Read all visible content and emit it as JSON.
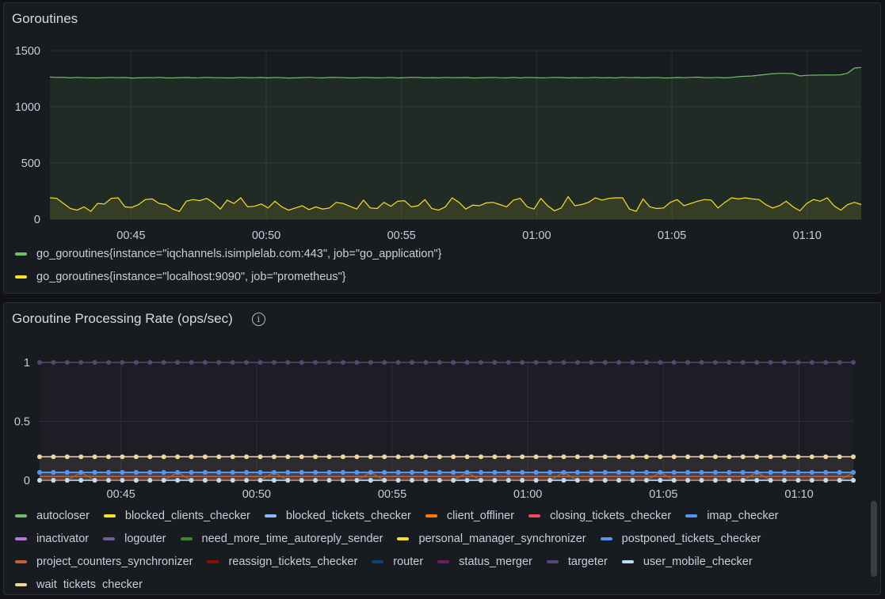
{
  "panels": {
    "goroutines": {
      "title": "Goroutines"
    },
    "rate": {
      "title": "Goroutine Processing Rate (ops/sec)",
      "info_icon": "info-icon"
    }
  },
  "x_tick_labels": [
    "00:45",
    "00:50",
    "00:55",
    "01:00",
    "01:05",
    "01:10"
  ],
  "chart_data": [
    {
      "type": "line",
      "title": "Goroutines",
      "x_range": [
        "00:42",
        "01:12"
      ],
      "x_ticks": [
        "00:45",
        "00:50",
        "00:55",
        "01:00",
        "01:05",
        "01:10"
      ],
      "y_ticks": [
        0,
        500,
        1000,
        1500
      ],
      "ylim": [
        0,
        1500
      ],
      "grid": true,
      "legend": "bottom",
      "series": [
        {
          "name": "go_goroutines{instance=\"iqchannels.isimplelab.com:443\", job=\"go_application\"}",
          "color": "#73bf69",
          "values": [
            1265,
            1262,
            1263,
            1258,
            1262,
            1259,
            1258,
            1257,
            1260,
            1262,
            1259,
            1261,
            1256,
            1258,
            1260,
            1259,
            1262,
            1258,
            1257,
            1260,
            1261,
            1258,
            1259,
            1262,
            1260,
            1259,
            1257,
            1258,
            1262,
            1260,
            1259,
            1261,
            1258,
            1262,
            1259,
            1256,
            1258,
            1260,
            1263,
            1259,
            1258,
            1261,
            1262,
            1260,
            1257,
            1258,
            1262,
            1260,
            1258,
            1259,
            1262,
            1257,
            1259,
            1263,
            1261,
            1258,
            1260,
            1258,
            1262,
            1259,
            1260,
            1261,
            1257,
            1258,
            1260,
            1262,
            1259,
            1258,
            1261,
            1257,
            1262,
            1260,
            1258,
            1259,
            1262,
            1261,
            1257,
            1260,
            1258,
            1259,
            1262,
            1258,
            1260,
            1257,
            1263,
            1259,
            1261,
            1258,
            1260,
            1262,
            1257,
            1258,
            1261,
            1259,
            1262,
            1264,
            1260,
            1259,
            1262,
            1258,
            1262,
            1268,
            1272,
            1275,
            1282,
            1288,
            1295,
            1298,
            1298,
            1296,
            1275,
            1280,
            1282,
            1283,
            1284,
            1283,
            1285,
            1300,
            1345,
            1350
          ]
        },
        {
          "name": "go_goroutines{instance=\"localhost:9090\", job=\"prometheus\"}",
          "color": "#fade2a",
          "values": [
            190,
            185,
            140,
            95,
            80,
            110,
            70,
            140,
            135,
            185,
            190,
            110,
            105,
            130,
            175,
            180,
            140,
            130,
            90,
            70,
            160,
            175,
            165,
            185,
            145,
            90,
            170,
            140,
            190,
            110,
            115,
            135,
            100,
            160,
            110,
            80,
            100,
            120,
            85,
            110,
            90,
            100,
            150,
            140,
            115,
            90,
            170,
            100,
            95,
            150,
            115,
            160,
            165,
            110,
            120,
            175,
            95,
            80,
            110,
            190,
            150,
            90,
            125,
            120,
            145,
            150,
            130,
            110,
            170,
            185,
            110,
            90,
            185,
            120,
            75,
            100,
            200,
            120,
            130,
            150,
            190,
            170,
            185,
            190,
            190,
            90,
            70,
            180,
            110,
            95,
            100,
            150,
            175,
            120,
            140,
            160,
            175,
            170,
            100,
            150,
            190,
            180,
            190,
            180,
            175,
            130,
            100,
            120,
            160,
            110,
            75,
            140,
            175,
            160,
            190,
            120,
            80,
            130,
            150,
            130
          ]
        }
      ]
    },
    {
      "type": "line",
      "title": "Goroutine Processing Rate (ops/sec)",
      "x_range": [
        "00:42",
        "01:12"
      ],
      "x_ticks": [
        "00:45",
        "00:50",
        "00:55",
        "01:00",
        "01:05",
        "01:10"
      ],
      "y_ticks": [
        0,
        0.5,
        1
      ],
      "ylim": [
        0,
        1
      ],
      "grid": true,
      "points": 60,
      "legend": "bottom",
      "series": [
        {
          "name": "autocloser",
          "color": "#73bf69",
          "value": 0.0
        },
        {
          "name": "blocked_clients_checker",
          "color": "#fade2a",
          "value": 0.0
        },
        {
          "name": "blocked_tickets_checker",
          "color": "#8ab8ff",
          "value": 0.067
        },
        {
          "name": "client_offliner",
          "color": "#ff780a",
          "value": 0.0
        },
        {
          "name": "closing_tickets_checker",
          "color": "#f2495c",
          "value": 0.0
        },
        {
          "name": "imap_checker",
          "color": "#5794f2",
          "value": 0.067
        },
        {
          "name": "inactivator",
          "color": "#b877d9",
          "value": 0.0
        },
        {
          "name": "logouter",
          "color": "#705da0",
          "value": 0.0
        },
        {
          "name": "need_more_time_autoreply_sender",
          "color": "#37872d",
          "value": 0.0
        },
        {
          "name": "personal_manager_synchronizer",
          "color": "#fade2a",
          "value": 0.0
        },
        {
          "name": "postponed_tickets_checker",
          "color": "#5794f2",
          "value": 0.067
        },
        {
          "name": "project_counters_synchronizer",
          "color": "#c4622d",
          "value": 0.033
        },
        {
          "name": "reassign_tickets_checker",
          "color": "#890f02",
          "value": 0.0
        },
        {
          "name": "router",
          "color": "#0a437c",
          "value": 0.0
        },
        {
          "name": "status_merger",
          "color": "#6d1f62",
          "value": 0.0
        },
        {
          "name": "targeter",
          "color": "#584477",
          "value": 1.0
        },
        {
          "name": "user_mobile_checker",
          "color": "#badff4",
          "value": 0.0
        },
        {
          "name": "wait_tickets_checker",
          "color": "#f4d598",
          "value": 0.2
        }
      ]
    }
  ]
}
